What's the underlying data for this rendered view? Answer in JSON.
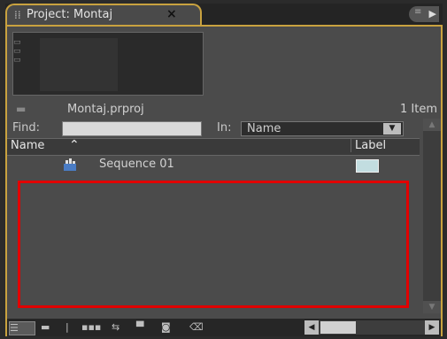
{
  "tab": {
    "title": "Project: Montaj",
    "grip": "⁞⁞",
    "close": "×"
  },
  "project": {
    "file": "Montaj.prproj",
    "count": "1 Item"
  },
  "search": {
    "find_label": "Find:",
    "in_label": "In:",
    "in_value": "Name",
    "placeholder": ""
  },
  "columns": {
    "name": "Name",
    "label": "Label"
  },
  "rows": [
    {
      "name": "Sequence 01",
      "label_color": "#c2dde0"
    }
  ],
  "colors": {
    "accent": "#c9a23f",
    "highlight": "#e10000",
    "panel": "#4b4b4b"
  },
  "icons": {
    "panel_menu": "panel-menu-icon",
    "sequence": "sequence-icon",
    "folder": "folder-icon"
  }
}
